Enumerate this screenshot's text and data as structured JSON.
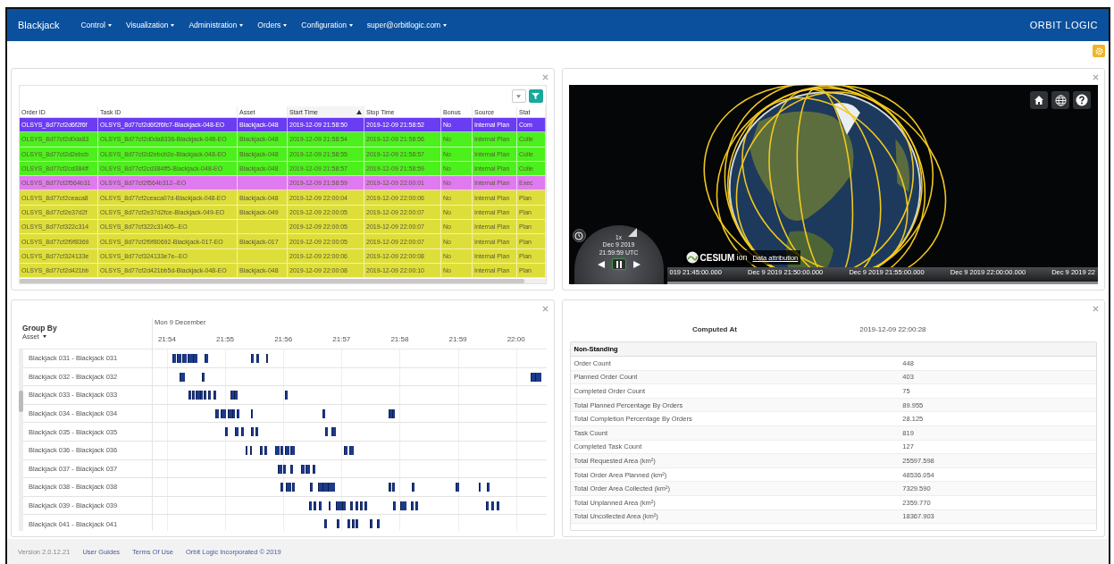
{
  "navbar": {
    "brand": "Blackjack",
    "menus": [
      {
        "label": "Control"
      },
      {
        "label": "Visualization"
      },
      {
        "label": "Administration"
      },
      {
        "label": "Orders"
      },
      {
        "label": "Configuration"
      }
    ],
    "user": "super@orbitlogic.com",
    "logo": "ORBIT LOGIC"
  },
  "orders_panel": {
    "columns": [
      {
        "label": "Order ID",
        "sorted": false
      },
      {
        "label": "Task ID",
        "sorted": false
      },
      {
        "label": "Asset",
        "sorted": false
      },
      {
        "label": "Start Time",
        "sorted": true
      },
      {
        "label": "Stop Time",
        "sorted": false
      },
      {
        "label": "Bonus",
        "sorted": false
      },
      {
        "label": "Source",
        "sorted": false
      },
      {
        "label": "Stat",
        "sorted": false
      }
    ],
    "rows": [
      {
        "color": "#6b3cf2",
        "cells": [
          "OLSYS_8d77cf2d6f2f6f",
          "OLSYS_8d77cf2d6f2f6fc7-Blackjack-048-EO",
          "Blackjack-048",
          "2019-12-09 21:58:50",
          "2019-12-09 21:58:52",
          "No",
          "Internal Plan",
          "Com"
        ]
      },
      {
        "color": "#4cf01c",
        "cells": [
          "OLSYS_8d77cf2d0da83",
          "OLSYS_8d77cf2d0da8336-Blackjack-048-EO",
          "Blackjack-048",
          "2019-12-09 21:58:54",
          "2019-12-09 21:58:56",
          "No",
          "Internal Plan",
          "Colle"
        ]
      },
      {
        "color": "#4cf01c",
        "cells": [
          "OLSYS_8d77cf2d2ebcb",
          "OLSYS_8d77cf2d2ebcb2e-Blackjack-048-EO",
          "Blackjack-048",
          "2019-12-09 21:58:55",
          "2019-12-09 21:58:57",
          "No",
          "Internal Plan",
          "Colle"
        ]
      },
      {
        "color": "#4cf01c",
        "cells": [
          "OLSYS_8d77cf2cd384ff",
          "OLSYS_8d77cf2cd384ff5-Blackjack-048-EO",
          "Blackjack-048",
          "2019-12-09 21:58:57",
          "2019-12-09 21:58:59",
          "No",
          "Internal Plan",
          "Colle"
        ]
      },
      {
        "color": "#e07af0",
        "cells": [
          "OLSYS_8d77cf2f564b31",
          "OLSYS_8d77cf2f564b312--EO",
          null,
          "2019-12-09 21:58:59",
          "2019-12-09 22:00:01",
          "No",
          "Internal Plan",
          "Exec"
        ]
      },
      {
        "color": "#dede3a",
        "cells": [
          "OLSYS_8d77cf2ceaca8",
          "OLSYS_8d77cf2ceaca07d-Blackjack-048-EO",
          "Blackjack-048",
          "2019-12-09 22:00:04",
          "2019-12-09 22:00:06",
          "No",
          "Internal Plan",
          "Plan"
        ]
      },
      {
        "color": "#dede3a",
        "cells": [
          "OLSYS_8d77cf2e37d2f",
          "OLSYS_8d77cf2e37d2fce-Blackjack-049-EO",
          "Blackjack-049",
          "2019-12-09 22:00:05",
          "2019-12-09 22:00:07",
          "No",
          "Internal Plan",
          "Plan"
        ]
      },
      {
        "color": "#dede3a",
        "cells": [
          "OLSYS_8d77cf322c314",
          "OLSYS_8d77cf322c31405--EO",
          null,
          "2019-12-09 22:00:05",
          "2019-12-09 22:00:07",
          "No",
          "Internal Plan",
          "Plan"
        ]
      },
      {
        "color": "#dede3a",
        "cells": [
          "OLSYS_8d77cf2f9f8369",
          "OLSYS_8d77cf2f9f80692-Blackjack-017-EO",
          "Blackjack-017",
          "2019-12-09 22:00:05",
          "2019-12-09 22:00:07",
          "No",
          "Internal Plan",
          "Plan"
        ]
      },
      {
        "color": "#dede3a",
        "cells": [
          "OLSYS_8d77cf324133e",
          "OLSYS_8d77cf324133e7e--EO",
          null,
          "2019-12-09 22:00:06",
          "2019-12-09 22:00:08",
          "No",
          "Internal Plan",
          "Plan"
        ]
      },
      {
        "color": "#dede3a",
        "cells": [
          "OLSYS_8d77cf2d421bb",
          "OLSYS_8d77cf2d421bb5d-Blackjack-048-EO",
          "Blackjack-048",
          "2019-12-09 22:00:08",
          "2019-12-09 22:00:10",
          "No",
          "Internal Plan",
          "Plan"
        ]
      }
    ]
  },
  "globe_panel": {
    "clock": {
      "speed": "1x",
      "date": "Dec 9 2019",
      "time": "21:59:59 UTC",
      "paused": true
    },
    "brand": "CESIUM",
    "brand_suffix": "ion",
    "attribution": "Data attribution",
    "timeline_labels": [
      "019 21:45:00.000",
      "Dec 9 2019 21:50:00.000",
      "Dec 9 2019 21:55:00.000",
      "Dec 9 2019 22:00:00.000",
      "Dec 9 2019 22"
    ]
  },
  "schedule_panel": {
    "group_by_label": "Group By",
    "group_by_value": "Asset",
    "date_label": "Mon 9 December",
    "ticks": [
      "21:54",
      "21:55",
      "21:56",
      "21:57",
      "21:58",
      "21:59",
      "22:00"
    ],
    "rows": [
      {
        "label": "Blackjack 031 - Blackjack 031"
      },
      {
        "label": "Blackjack 032 - Blackjack 032"
      },
      {
        "label": "Blackjack 033 - Blackjack 033"
      },
      {
        "label": "Blackjack 034 - Blackjack 034"
      },
      {
        "label": "Blackjack 035 - Blackjack 035"
      },
      {
        "label": "Blackjack 036 - Blackjack 036"
      },
      {
        "label": "Blackjack 037 - Blackjack 037"
      },
      {
        "label": "Blackjack 038 - Blackjack 038"
      },
      {
        "label": "Blackjack 039 - Blackjack 039"
      },
      {
        "label": "Blackjack 041 - Blackjack 041"
      }
    ]
  },
  "stats_panel": {
    "computed_label": "Computed At",
    "computed_value": "2019-12-09 22:00:28",
    "section": "Non-Standing",
    "rows": [
      {
        "label": "Order Count",
        "value": "448"
      },
      {
        "label": "Planned Order Count",
        "value": "403"
      },
      {
        "label": "Completed Order Count",
        "value": "75"
      },
      {
        "label": "Total Planned Percentage By Orders",
        "value": "89.955"
      },
      {
        "label": "Total Completion Percentage By Orders",
        "value": "28.125"
      },
      {
        "label": "Task Count",
        "value": "819"
      },
      {
        "label": "Completed Task Count",
        "value": "127"
      },
      {
        "label": "Total Requested Area (km²)",
        "value": "25597.598"
      },
      {
        "label": "Total Order Area Planned (km²)",
        "value": "48536.054"
      },
      {
        "label": "Total Order Area Collected (km²)",
        "value": "7329.590"
      },
      {
        "label": "Total Unplanned Area (km²)",
        "value": "2359.770"
      },
      {
        "label": "Total Uncollected Area (km²)",
        "value": "18367.903"
      }
    ]
  },
  "footer": {
    "version": "Version 2.0.12.21",
    "links": [
      "User Guides",
      "Terms Of Use",
      "Orbit Logic Incorporated © 2019"
    ]
  }
}
